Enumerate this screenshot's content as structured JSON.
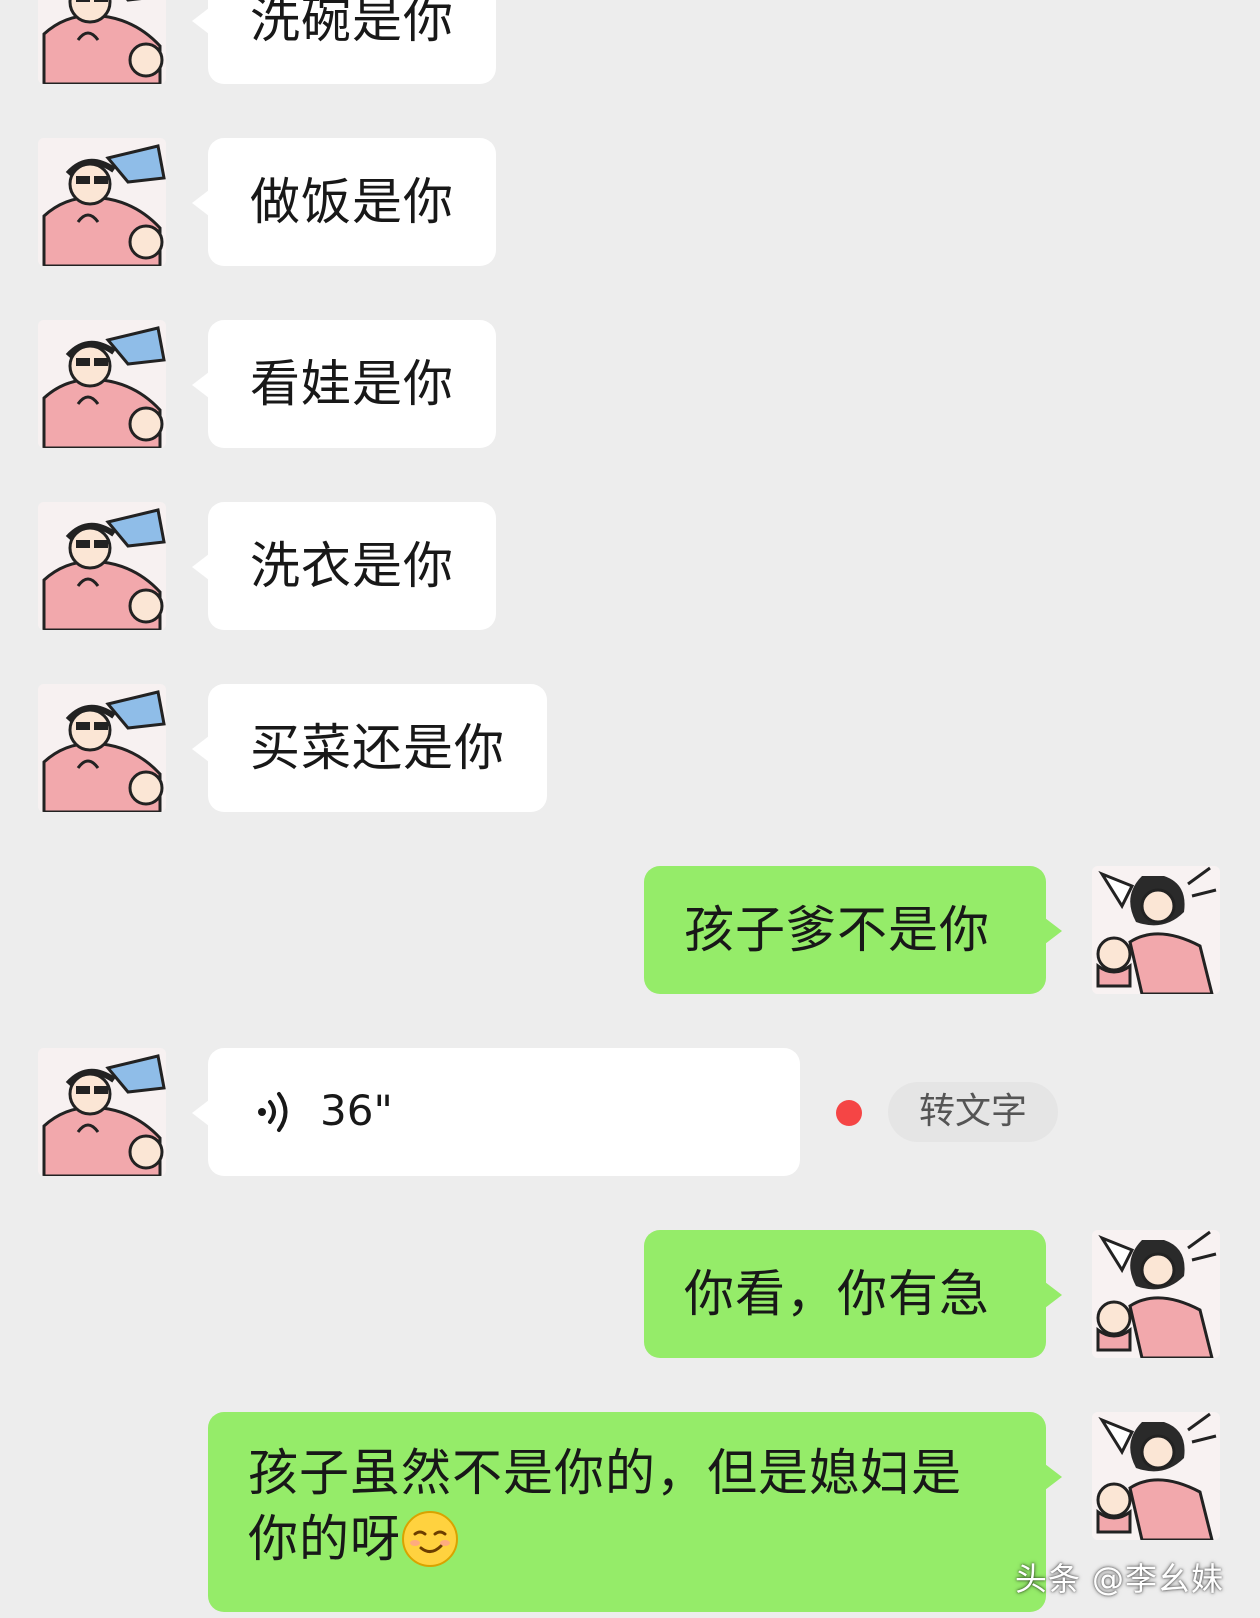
{
  "messages": {
    "m1": "洗碗是你",
    "m2": "做饭是你",
    "m3": "看娃是你",
    "m4": "洗衣是你",
    "m5": "买菜还是你",
    "m6": "孩子爹不是你",
    "voice": {
      "duration": "36\"",
      "to_text_label": "转文字"
    },
    "m7": "你看，你有急",
    "m8": "孩子虽然不是你的，但是媳妇是你的呀"
  },
  "icons": {
    "voice": "voice-wave-icon",
    "emoji": "smirk-emoji-icon",
    "unread": "unread-dot"
  },
  "colors": {
    "background": "#ededed",
    "incoming_bubble": "#ffffff",
    "outgoing_bubble": "#95ec69",
    "unread_dot": "#f54545"
  },
  "watermark": "头条 @李幺妹"
}
